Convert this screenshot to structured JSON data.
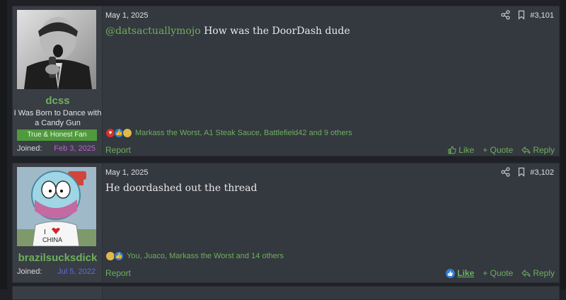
{
  "posts": [
    {
      "user": {
        "name": "dcss",
        "title": "I Was Born to Dance with a Candy Gun",
        "banner": "True & Honest Fan",
        "joined_label": "Joined:",
        "joined_date": "Feb 3, 2025"
      },
      "date": "May 1, 2025",
      "number": "#3,101",
      "mention": "@datsactuallymojo",
      "text": "How was the DoorDash dude",
      "reactions": "Markass the Worst, A1 Steak Sauce, Battlefield42 and 9 others",
      "report": "Report",
      "like": "Like",
      "quote": "+ Quote",
      "reply": "Reply"
    },
    {
      "user": {
        "name": "brazilsucksdick",
        "joined_label": "Joined:",
        "joined_date": "Jul 5, 2022",
        "avatar_text": "I ♥ CHINA"
      },
      "date": "May 1, 2025",
      "number": "#3,102",
      "text": "He doordashed out the thread",
      "reactions": "You, Juaco, Markass the Worst and 14 others",
      "report": "Report",
      "like": "Like",
      "quote": "+ Quote",
      "reply": "Reply"
    }
  ],
  "colors": {
    "accent": "#6db05c",
    "joined1": "#c05fd8",
    "joined2": "#5a6ed8",
    "card": "#34383f"
  }
}
